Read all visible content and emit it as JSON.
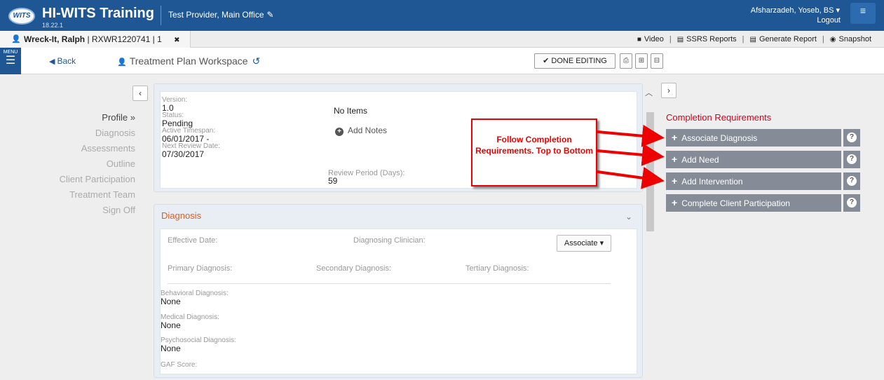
{
  "header": {
    "logo_text": "WITS",
    "app_title": "HI-WITS Training",
    "version": "18.22.1",
    "provider": "Test Provider, Main Office",
    "user": "Afsharzadeh, Yoseb, BS ▾",
    "logout": "Logout"
  },
  "client_bar": {
    "client_name": "Wreck-It, Ralph",
    "client_id": " | RXWR1220741 | 1",
    "links": {
      "video": "Video",
      "ssrs": "SSRS Reports",
      "generate": "Generate Report",
      "snapshot": "Snapshot"
    }
  },
  "toolbar": {
    "menu_label": "MENU",
    "back": "Back",
    "workspace_title": "Treatment Plan Workspace",
    "done_editing": "DONE EDITING"
  },
  "left_nav": {
    "items": [
      "Profile »",
      "Diagnosis",
      "Assessments",
      "Outline",
      "Client Participation",
      "Treatment Team",
      "Sign Off"
    ]
  },
  "profile": {
    "version_label": "Version:",
    "version": "1.0",
    "status_label": "Status:",
    "status": "Pending",
    "timespan_label": "Active Timespan:",
    "timespan": "06/01/2017 -",
    "review_date_label": "Next Review Date:",
    "review_date": "07/30/2017",
    "no_items": "No Items",
    "add_notes": "Add Notes",
    "review_period_label": "Review Period (Days):",
    "review_period": "59"
  },
  "diagnosis": {
    "title": "Diagnosis",
    "effective_date_label": "Effective Date:",
    "clinician_label": "Diagnosing Clinician:",
    "associate_btn": "Associate ▾",
    "primary_label": "Primary Diagnosis:",
    "secondary_label": "Secondary Diagnosis:",
    "tertiary_label": "Tertiary Diagnosis:",
    "behavioral_label": "Behavioral Diagnosis:",
    "behavioral": "None",
    "medical_label": "Medical Diagnosis:",
    "medical": "None",
    "psychosocial_label": "Psychosocial Diagnosis:",
    "psychosocial": "None",
    "gaf_label": "GAF Score:"
  },
  "requirements": {
    "title": "Completion Requirements",
    "items": [
      "Associate Diagnosis",
      "Add Need",
      "Add Intervention",
      "Complete Client Participation"
    ]
  },
  "annotation": {
    "callout": "Follow Completion Requirements. Top to Bottom"
  },
  "colors": {
    "header": "#1f5795",
    "requirement_title": "#d0021b",
    "requirement_item": "#858c98",
    "diagnosis_title": "#e15b1a",
    "annotation": "#e00000"
  }
}
